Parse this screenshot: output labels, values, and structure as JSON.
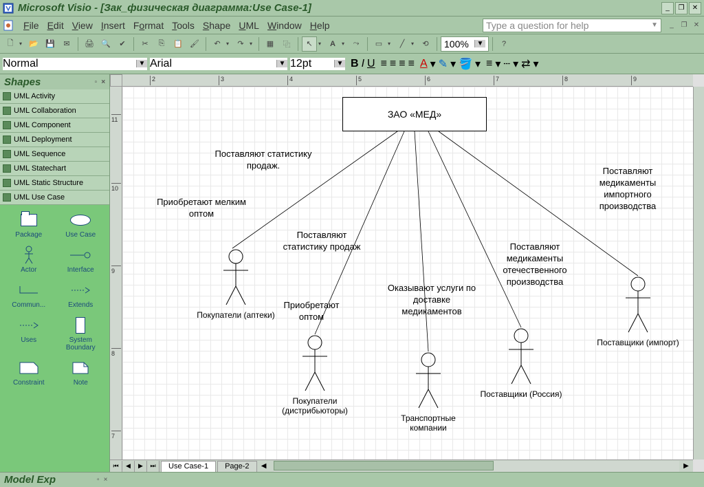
{
  "titlebar": {
    "title": "Microsoft Visio - [Зак_физическая диаграмма:Use Case-1]"
  },
  "menu": {
    "items": [
      "File",
      "Edit",
      "View",
      "Insert",
      "Format",
      "Tools",
      "Shape",
      "UML",
      "Window",
      "Help"
    ],
    "question_placeholder": "Type a question for help"
  },
  "toolbar": {
    "zoom": "100%"
  },
  "format": {
    "style": "Normal",
    "font": "Arial",
    "size": "12pt"
  },
  "shapes_panel": {
    "title": "Shapes",
    "stencils": [
      "UML Activity",
      "UML Collaboration",
      "UML Component",
      "UML Deployment",
      "UML Sequence",
      "UML Statechart",
      "UML Static Structure",
      "UML Use Case"
    ],
    "shapes": [
      "Package",
      "Use Case",
      "Actor",
      "Interface",
      "Commun...",
      "Extends",
      "Uses",
      "System Boundary",
      "Constraint",
      "Note"
    ]
  },
  "ruler_h": [
    "2",
    "3",
    "4",
    "5",
    "6",
    "7",
    "8",
    "9"
  ],
  "ruler_v": [
    "11",
    "10",
    "9",
    "8",
    "7"
  ],
  "diagram": {
    "main_box": "ЗАО «МЕД»",
    "labels": {
      "l1": "Поставляют статистику продаж.",
      "l2": "Приобретают мелким оптом",
      "l3": "Поставляют статистику продаж",
      "l4": "Приобретают оптом",
      "l5": "Оказывают услуги по доставке медикаментов",
      "l6": "Поставляют медикаменты отечественного производства",
      "l7": "Поставляют медикаменты импортного производства"
    },
    "actors": {
      "a1": "Покупатели (аптеки)",
      "a2": "Покупатели (дистрибьюторы)",
      "a3": "Транспортные компании",
      "a4": "Поставщики (Россия)",
      "a5": "Поставщики (импорт)"
    }
  },
  "tabs": {
    "active": "Use Case-1",
    "other": "Page-2"
  },
  "bottom": {
    "title": "Model Exp"
  }
}
